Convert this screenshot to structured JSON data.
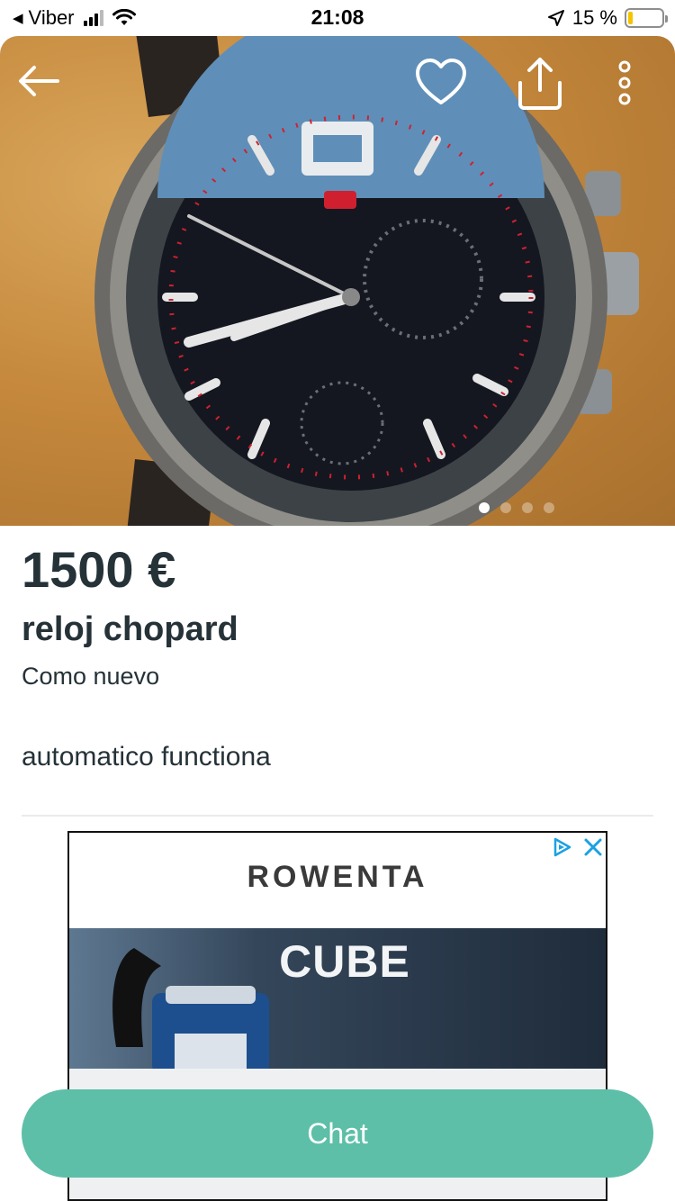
{
  "status_bar": {
    "back_app": "Viber",
    "time": "21:08",
    "battery_text": "15 %",
    "battery_level": 0.15
  },
  "hero": {
    "photo_count": 4,
    "active_photo": 1,
    "icons": [
      "back-arrow-icon",
      "heart-icon",
      "share-icon",
      "more-vertical-icon"
    ]
  },
  "listing": {
    "price": "1500 €",
    "title": "reloj  chopard",
    "condition": "Como nuevo",
    "description": "automatico  functiona"
  },
  "ad": {
    "brand": "Rowenta",
    "product": "CUBE",
    "adchoices_icon": "adchoices-icon",
    "close_icon": "close-icon"
  },
  "actions": {
    "chat_label": "Chat"
  },
  "colors": {
    "accent": "#5dbfa8",
    "text": "#253238",
    "battery": "#f5c400",
    "ad_link": "#1ba1e2"
  }
}
